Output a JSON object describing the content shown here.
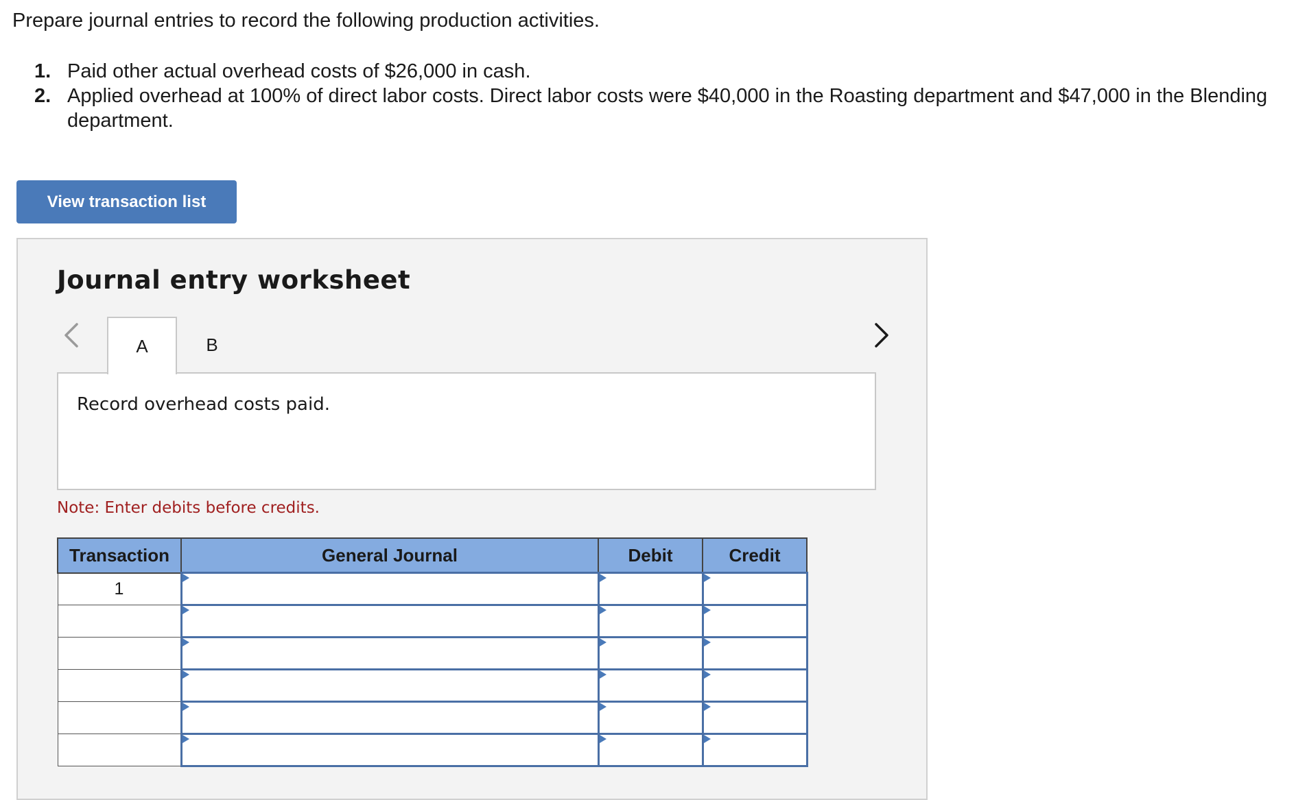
{
  "instructions": "Prepare journal entries to record the following production activities.",
  "problems": [
    {
      "number": "1.",
      "text": "Paid other actual overhead costs of $26,000 in cash."
    },
    {
      "number": "2.",
      "text": "Applied overhead at 100% of direct labor costs. Direct labor costs were $40,000 in the Roasting department and $47,000 in the Blending department."
    }
  ],
  "view_button_label": "View transaction list",
  "worksheet": {
    "title": "Journal entry worksheet",
    "tabs": [
      {
        "label": "A",
        "active": true
      },
      {
        "label": "B",
        "active": false
      }
    ],
    "description": "Record overhead costs paid.",
    "note": "Note: Enter debits before credits."
  },
  "journal": {
    "headers": {
      "transaction": "Transaction",
      "general_journal": "General Journal",
      "debit": "Debit",
      "credit": "Credit"
    },
    "rows": [
      {
        "transaction": "1",
        "account": "",
        "debit": "",
        "credit": ""
      },
      {
        "transaction": "",
        "account": "",
        "debit": "",
        "credit": ""
      },
      {
        "transaction": "",
        "account": "",
        "debit": "",
        "credit": ""
      },
      {
        "transaction": "",
        "account": "",
        "debit": "",
        "credit": ""
      },
      {
        "transaction": "",
        "account": "",
        "debit": "",
        "credit": ""
      },
      {
        "transaction": "",
        "account": "",
        "debit": "",
        "credit": ""
      }
    ]
  },
  "colors": {
    "button": "#4a7ab9",
    "header": "#84abe0",
    "note": "#a02020"
  },
  "icons": {
    "prev": "chevron-left-icon",
    "next": "chevron-right-icon"
  }
}
